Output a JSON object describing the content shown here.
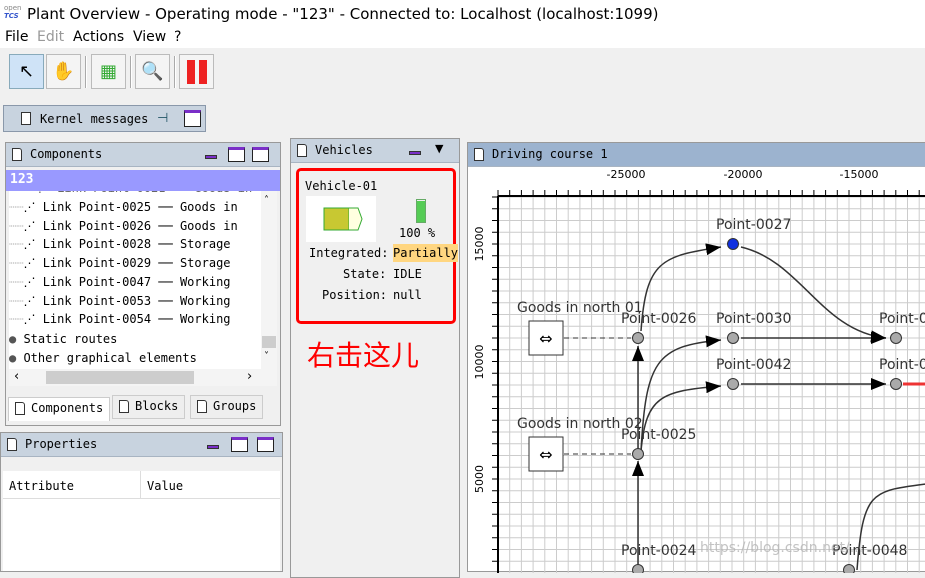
{
  "window": {
    "logo_top": "open",
    "logo_bottom": "TCS",
    "title": "Plant Overview - Operating mode - \"123\" - Connected to: Localhost (localhost:1099)"
  },
  "menu": [
    "File",
    "Edit",
    "Actions",
    "View",
    "?"
  ],
  "toolbar": [
    {
      "icon": "select-arrow-icon",
      "active": true
    },
    {
      "icon": "hand-icon"
    },
    {
      "icon": "create-order-icon"
    },
    {
      "icon": "find-vehicle-icon"
    },
    {
      "icon": "pause-icon"
    }
  ],
  "kernel_tab": {
    "label": "Kernel messages"
  },
  "components": {
    "title": "Components",
    "selected": "123",
    "items": [
      "Link Point-0025 ── Goods in",
      "Link Point-0026 ── Goods in",
      "Link Point-0028 ── Storage",
      "Link Point-0029 ── Storage",
      "Link Point-0047 ── Working",
      "Link Point-0053 ── Working",
      "Link Point-0054 ── Working"
    ],
    "groups": [
      "Static routes",
      "Other graphical elements"
    ],
    "tabs": [
      "Components",
      "Blocks",
      "Groups"
    ]
  },
  "properties": {
    "title": "Properties",
    "columns": [
      "Attribute",
      "Value"
    ]
  },
  "vehicles": {
    "title": "Vehicles",
    "vehicle": {
      "name": "Vehicle-01",
      "battery": "100 %",
      "battery_level": 100,
      "integrated_label": "Integrated:",
      "integrated": "Partially",
      "state_label": "State:",
      "state": "IDLE",
      "position_label": "Position:",
      "position": "null"
    },
    "colors": {
      "highlight": "#ff0000",
      "integrated_bg": "#ffd680",
      "vehicle": "#c8c832"
    }
  },
  "annotation": "右击这儿",
  "driving_course": {
    "title": "Driving course 1",
    "x_ticks": [
      "-25000",
      "-20000",
      "-15000"
    ],
    "y_ticks": [
      "15000",
      "10000",
      "5000"
    ],
    "stations": [
      "Goods in north 01",
      "Goods in north 02"
    ],
    "points": [
      "Point-0027",
      "Point-0026",
      "Point-0030",
      "Point-0042",
      "Point-0",
      "Point-0",
      "Point-0025",
      "Point-0024",
      "Point-0048"
    ]
  },
  "watermark": "https://blog.csdn.net/..."
}
